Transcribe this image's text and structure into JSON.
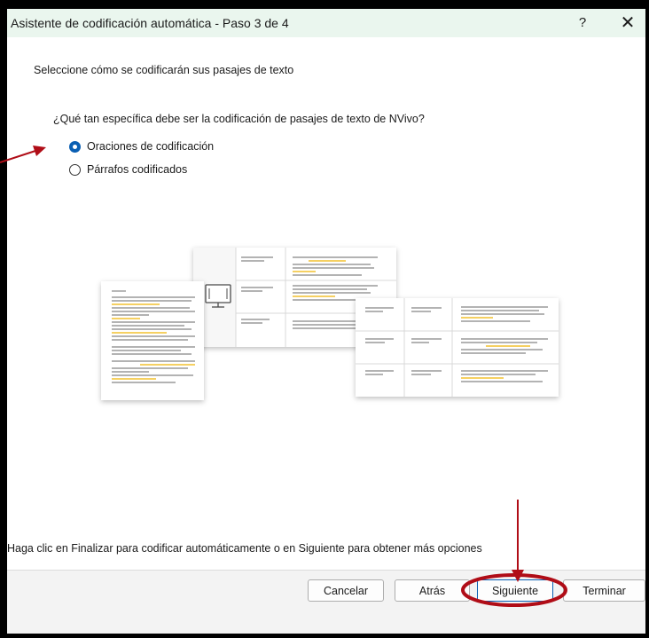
{
  "window": {
    "title": "Asistente de codificación automática - Paso 3 de 4",
    "help_label": "?",
    "close_label": "✕"
  },
  "content": {
    "subtitle": "Seleccione cómo se codificarán sus pasajes de texto",
    "question": "¿Qué tan específica debe ser la codificación de pasajes de texto de NVivo?",
    "options": [
      {
        "label": "Oraciones de codificación",
        "checked": true
      },
      {
        "label": "Párrafos codificados",
        "checked": false
      }
    ],
    "hint": "Haga clic en Finalizar para codificar automáticamente o en Siguiente para obtener más opciones"
  },
  "buttons": {
    "cancel": "Cancelar",
    "back": "Atrás",
    "next": "Siguiente",
    "finish": "Terminar"
  },
  "colors": {
    "titlebar": "#eaf6ee",
    "accent": "#0a5fb3",
    "annotation": "#b00d17",
    "highlight": "#f2c12e"
  }
}
